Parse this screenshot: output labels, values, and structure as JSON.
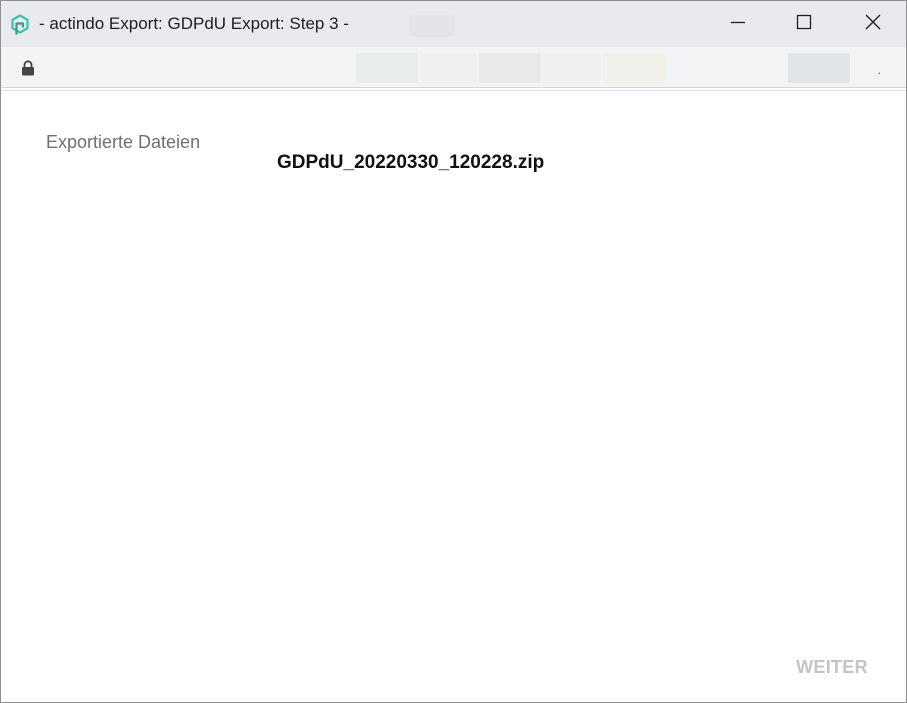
{
  "window": {
    "title": "- actindo Export: GDPdU Export: Step 3 -",
    "app_icon": "actindo-logo-icon",
    "controls": {
      "minimize_icon": "minimize-icon",
      "maximize_icon": "maximize-icon",
      "close_icon": "close-icon"
    }
  },
  "addressbar": {
    "lock_icon": "lock-icon",
    "trailing_text": "."
  },
  "content": {
    "exported_files_label": "Exportierte Dateien",
    "exported_file_name": "GDPdU_20220330_120228.zip"
  },
  "footer": {
    "next_button_label": "WEITER",
    "next_button_enabled": false
  },
  "colors": {
    "titlebar_bg": "#e8eaed",
    "addressbar_bg": "#f1f3f4",
    "logo_accent": "#3fbfad",
    "label_gray": "#707070",
    "disabled_button_text": "#c4c4c4"
  }
}
